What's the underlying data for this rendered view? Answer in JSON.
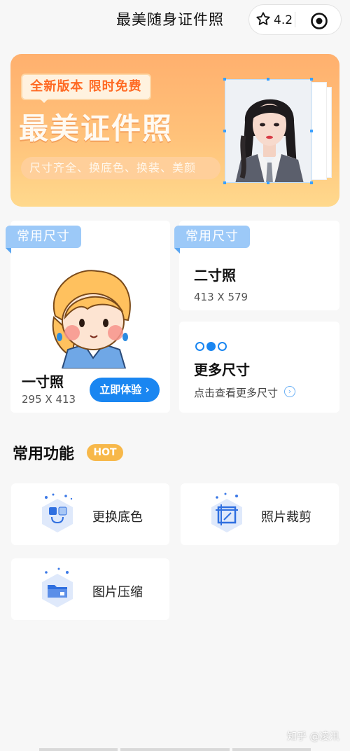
{
  "header": {
    "title": "最美随身证件照",
    "rating": "4.2"
  },
  "banner": {
    "tag": "全新版本  限时免费",
    "headline": "最美证件照",
    "subline": "尺寸齐全、换底色、换装、美颜"
  },
  "cards": {
    "ribbon_label": "常用尺寸",
    "one_inch": {
      "name": "一寸照",
      "size": "295 X 413",
      "button": "立即体验"
    },
    "two_inch": {
      "name": "二寸照",
      "size": "413 X 579"
    },
    "more": {
      "title": "更多尺寸",
      "link": "点击查看更多尺寸"
    }
  },
  "functions": {
    "title": "常用功能",
    "badge": "HOT",
    "items": [
      {
        "label": "更换底色",
        "icon": "swap-color-icon"
      },
      {
        "label": "照片裁剪",
        "icon": "crop-icon"
      },
      {
        "label": "图片压缩",
        "icon": "compress-folder-icon"
      }
    ]
  },
  "watermark": "知乎 @凌汛",
  "colors": {
    "accent": "#1a86f1",
    "ribbon": "#9cc9f8",
    "hot": "#f7b84a",
    "banner_top": "#ffb06e"
  }
}
